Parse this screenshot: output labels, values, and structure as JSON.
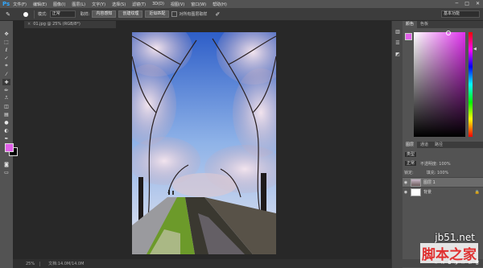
{
  "app": {
    "logo": "Ps"
  },
  "menu": {
    "items": [
      "文件(F)",
      "编辑(E)",
      "图像(I)",
      "图层(L)",
      "文字(Y)",
      "选择(S)",
      "滤镜(T)",
      "3D(D)",
      "视图(V)",
      "窗口(W)",
      "帮助(H)"
    ]
  },
  "window_controls": {
    "minimize": "─",
    "maximize": "□",
    "close": "✕"
  },
  "options": {
    "mode_label": "模式:",
    "mode_value": "正常",
    "sample_label": "取样:",
    "sample_btn": "内容感知",
    "create_btn": "创建纹理",
    "proximity_btn": "近似匹配",
    "all_layers_label": "对所有图层取样",
    "workspace": "基本功能"
  },
  "document": {
    "tab": "01.jpg @ 25% (RGB/8*)",
    "close": "×"
  },
  "status": {
    "zoom": "25%",
    "doc_info": "文档:14.0M/14.0M"
  },
  "panels": {
    "color_tabs": [
      "颜色",
      "色板"
    ],
    "layers_tabs": [
      "图层",
      "通道",
      "路径"
    ],
    "kind_label": "类型",
    "blend_mode": "正常",
    "opacity_label": "不透明度: 100%",
    "lock_label": "锁定:",
    "fill_label": "填充: 100%",
    "layers": [
      {
        "name": "图层 1",
        "selected": true
      },
      {
        "name": "背景",
        "selected": false
      }
    ]
  },
  "watermark": {
    "url": "jb51.net",
    "text": "脚本之家"
  },
  "colors": {
    "foreground": "#e060e8",
    "background": "#000000",
    "accent": "#31a8ff"
  }
}
